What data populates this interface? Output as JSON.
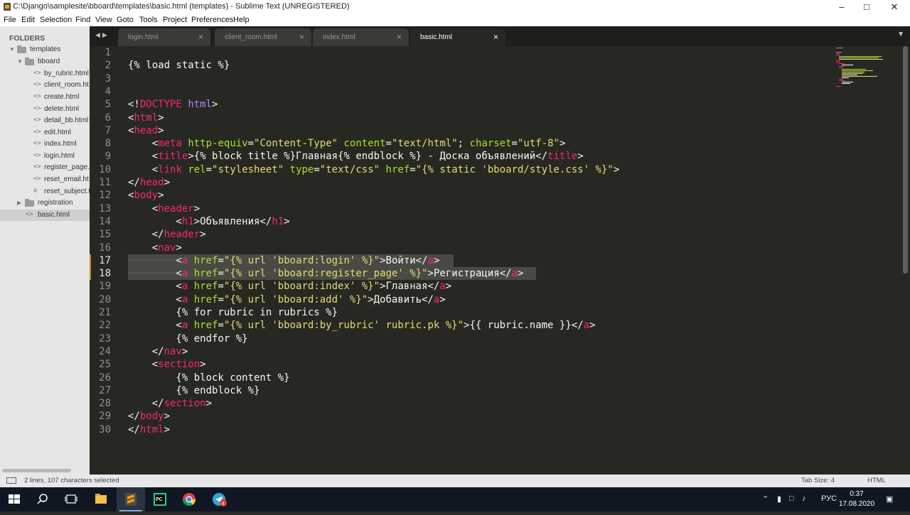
{
  "window": {
    "title": "C:\\Django\\samplesite\\bboard\\templates\\basic.html (templates) - Sublime Text (UNREGISTERED)",
    "minimize_icon": "minimize-icon",
    "maximize_icon": "maximize-icon",
    "close_icon": "close-icon"
  },
  "menu": [
    "File",
    "Edit",
    "Selection",
    "Find",
    "View",
    "Goto",
    "Tools",
    "Project",
    "Preferences",
    "Help"
  ],
  "sidebar": {
    "header": "FOLDERS",
    "root": "templates",
    "bboard_folder": "bboard",
    "files": [
      "by_rubric.html",
      "client_room.ht",
      "create.html",
      "delete.html",
      "detail_bb.html",
      "edit.html",
      "index.html",
      "login.html",
      "register_page.",
      "reset_email.ht",
      "reset_subject.t"
    ],
    "registration_folder": "registration",
    "basic_file": "basic.html"
  },
  "tabs": [
    {
      "label": "login.html",
      "active": false
    },
    {
      "label": "client_room.html",
      "active": false
    },
    {
      "label": "index.html",
      "active": false
    },
    {
      "label": "basic.html",
      "active": true
    }
  ],
  "editor": {
    "line_numbers": [
      "1",
      "2",
      "3",
      "4",
      "5",
      "6",
      "7",
      "8",
      "9",
      "10",
      "11",
      "12",
      "13",
      "14",
      "15",
      "16",
      "17",
      "18",
      "19",
      "20",
      "21",
      "22",
      "23",
      "24",
      "25",
      "26",
      "27",
      "28",
      "29",
      "30"
    ],
    "selected_lines": [
      17,
      18
    ]
  },
  "statusbar": {
    "selection": "2 lines, 107 characters selected",
    "tab_size": "Tab Size: 4",
    "syntax": "HTML"
  },
  "taskbar": {
    "language": "РУС",
    "time": "0:37",
    "date": "17.08.2020",
    "notification_count": "4"
  },
  "colors": {
    "editor_bg": "#272822",
    "tag": "#f92672",
    "attribute": "#a6e22e",
    "string": "#e6db74",
    "doctype": "#ae81ff"
  }
}
